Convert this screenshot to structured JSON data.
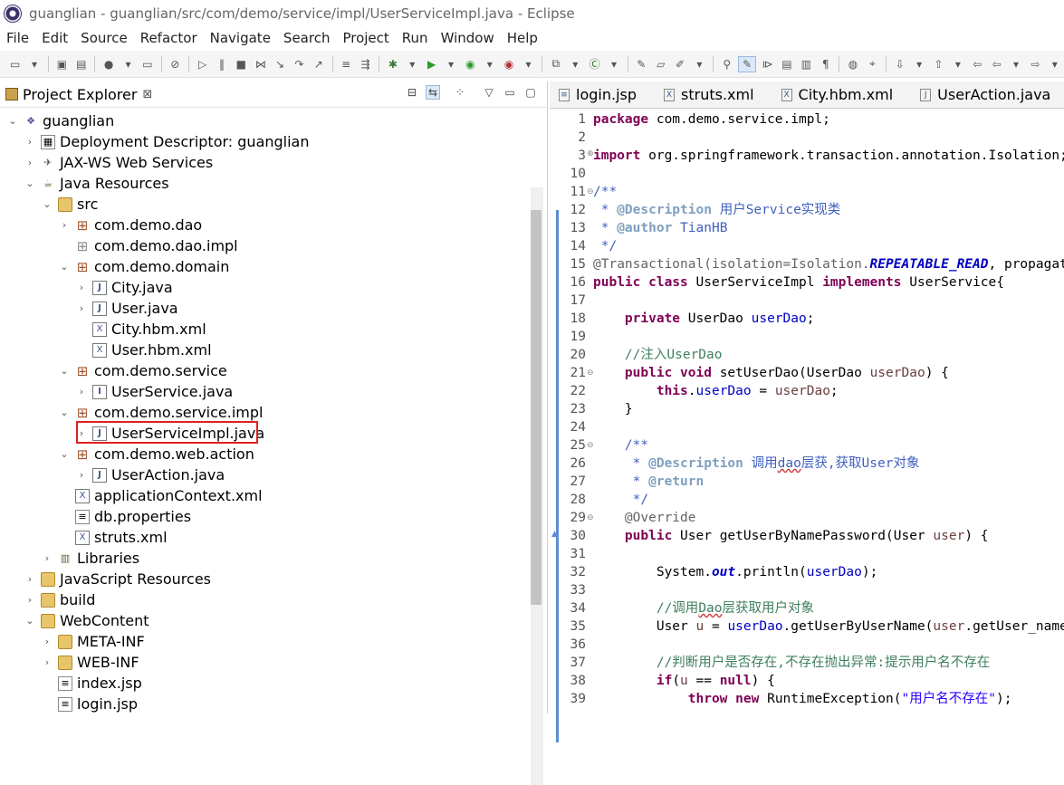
{
  "window": {
    "title": "guanglian - guanglian/src/com/demo/service/impl/UserServiceImpl.java - Eclipse"
  },
  "menu": [
    "File",
    "Edit",
    "Source",
    "Refactor",
    "Navigate",
    "Search",
    "Project",
    "Run",
    "Window",
    "Help"
  ],
  "explorer": {
    "title": "Project Explorer",
    "close": "⊠",
    "items": [
      {
        "label": "guanglian",
        "icon": "project-icon"
      },
      {
        "label": "Deployment Descriptor: guanglian",
        "icon": "descriptor-icon"
      },
      {
        "label": "JAX-WS Web Services",
        "icon": "webservice-icon"
      },
      {
        "label": "Java Resources",
        "icon": "java-resources-icon"
      },
      {
        "label": "src",
        "icon": "source-folder-icon"
      },
      {
        "label": "com.demo.dao",
        "icon": "package-icon"
      },
      {
        "label": "com.demo.dao.impl",
        "icon": "empty-package-icon"
      },
      {
        "label": "com.demo.domain",
        "icon": "package-icon"
      },
      {
        "label": "City.java",
        "icon": "java-file-icon"
      },
      {
        "label": "User.java",
        "icon": "java-file-icon"
      },
      {
        "label": "City.hbm.xml",
        "icon": "xml-file-icon"
      },
      {
        "label": "User.hbm.xml",
        "icon": "xml-file-icon"
      },
      {
        "label": "com.demo.service",
        "icon": "package-icon"
      },
      {
        "label": "UserService.java",
        "icon": "java-interface-icon"
      },
      {
        "label": "com.demo.service.impl",
        "icon": "package-icon"
      },
      {
        "label": "UserServiceImpl.java",
        "icon": "java-file-icon"
      },
      {
        "label": "com.demo.web.action",
        "icon": "package-icon"
      },
      {
        "label": "UserAction.java",
        "icon": "java-file-icon"
      },
      {
        "label": "applicationContext.xml",
        "icon": "xml-file-icon"
      },
      {
        "label": "db.properties",
        "icon": "properties-file-icon"
      },
      {
        "label": "struts.xml",
        "icon": "xml-file-icon"
      },
      {
        "label": "Libraries",
        "icon": "libraries-icon"
      },
      {
        "label": "JavaScript Resources",
        "icon": "js-resources-icon"
      },
      {
        "label": "build",
        "icon": "folder-icon"
      },
      {
        "label": "WebContent",
        "icon": "folder-icon"
      },
      {
        "label": "META-INF",
        "icon": "folder-icon"
      },
      {
        "label": "WEB-INF",
        "icon": "folder-icon"
      },
      {
        "label": "index.jsp",
        "icon": "jsp-file-icon"
      },
      {
        "label": "login.jsp",
        "icon": "jsp-file-icon"
      }
    ]
  },
  "editor": {
    "tabs": [
      "login.jsp",
      "struts.xml",
      "City.hbm.xml",
      "UserAction.java"
    ],
    "line_numbers": [
      "1",
      "2",
      "3",
      "10",
      "11",
      "12",
      "13",
      "14",
      "15",
      "16",
      "17",
      "18",
      "19",
      "20",
      "21",
      "22",
      "23",
      "24",
      "25",
      "26",
      "27",
      "28",
      "29",
      "30",
      "31",
      "32",
      "33",
      "34",
      "35",
      "36",
      "37",
      "38",
      "39"
    ],
    "code": {
      "l1_kw": "package",
      "l1_rest": " com.demo.service.impl;",
      "l3_kw": "import",
      "l3_rest": " org.springframework.transaction.annotation.Isolation;",
      "l11": "/**",
      "l12_pre": " * ",
      "l12_tag": "@Description",
      "l12_text": " 用户Service实现类",
      "l13_pre": " * ",
      "l13_tag": "@author",
      "l13_text": " TianHB",
      "l14": " */",
      "l15_a": "@Transactional(isolation=Isolation.",
      "l15_b": "REPEATABLE_READ",
      "l15_c": ", propagation",
      "l16_kw1": "public",
      "l16_kw2": "class",
      "l16_mid": " UserServiceImpl ",
      "l16_kw3": "implements",
      "l16_end": " UserService{",
      "l18_kw": "private",
      "l18_mid": " UserDao ",
      "l18_fld": "userDao",
      "l18_end": ";",
      "l20": "//注入UserDao",
      "l21_kw1": "public",
      "l21_kw2": "void",
      "l21_mid": " setUserDao(UserDao ",
      "l21_param": "userDao",
      "l21_end": ") {",
      "l22_kw": "this",
      "l22_dot": ".",
      "l22_fld": "userDao",
      "l22_eq": " = ",
      "l22_param": "userDao",
      "l22_end": ";",
      "l23": "}",
      "l25": "/**",
      "l26_pre": " * ",
      "l26_tag": "@Description",
      "l26_a": " 调用",
      "l26_dao": "dao",
      "l26_b": "层获,获取User对象",
      "l27_pre": " * ",
      "l27_tag": "@return",
      "l28": " */",
      "l29": "@Override",
      "l30_kw": "public",
      "l30_mid": " User getUserByNamePassword(User ",
      "l30_param": "user",
      "l30_end": ") {",
      "l32_a": "System.",
      "l32_out": "out",
      "l32_b": ".println(",
      "l32_fld": "userDao",
      "l32_c": ");",
      "l34_a": "//调用",
      "l34_dao": "Dao",
      "l34_b": "层获取用户对象",
      "l35_a": "User ",
      "l35_u": "u",
      "l35_b": " = ",
      "l35_fld": "userDao",
      "l35_c": ".getUserByUserName(",
      "l35_user": "user",
      "l35_d": ".getUser_name());",
      "l37": "//判断用户是否存在,不存在抛出异常:提示用户名不存在",
      "l38_kw": "if",
      "l38_a": "(",
      "l38_u": "u",
      "l38_b": " == ",
      "l38_null": "null",
      "l38_c": ") {",
      "l39_kw1": "throw",
      "l39_kw2": "new",
      "l39_a": " RuntimeException(",
      "l39_str": "\"用户名不存在\"",
      "l39_b": ");"
    }
  }
}
